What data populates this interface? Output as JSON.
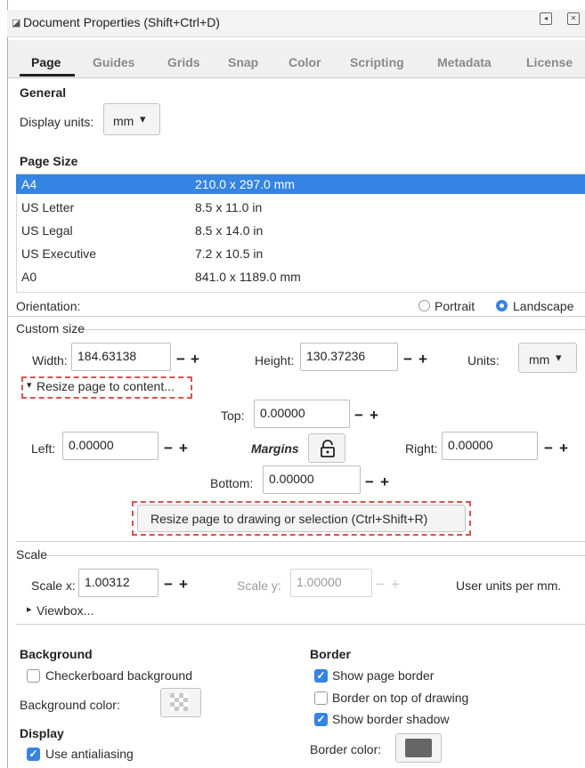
{
  "window": {
    "title": "Document Properties (Shift+Ctrl+D)",
    "restore_glyph": "◂",
    "close_glyph": "✕"
  },
  "tabs": [
    "Page",
    "Guides",
    "Grids",
    "Snap",
    "Color",
    "Scripting",
    "Metadata",
    "License"
  ],
  "general": {
    "heading": "General",
    "display_units_label": "Display units:",
    "display_units_value": "mm"
  },
  "page_size": {
    "heading": "Page Size",
    "rows": [
      {
        "name": "A4",
        "size": "210.0 x 297.0 mm",
        "selected": true
      },
      {
        "name": "US Letter",
        "size": "8.5 x 11.0 in"
      },
      {
        "name": "US Legal",
        "size": "8.5 x 14.0 in"
      },
      {
        "name": "US Executive",
        "size": "7.2 x 10.5 in"
      },
      {
        "name": "A0",
        "size": "841.0 x 1189.0 mm"
      }
    ]
  },
  "orientation": {
    "label": "Orientation:",
    "portrait": "Portrait",
    "landscape": "Landscape",
    "selected": "Landscape"
  },
  "custom_size": {
    "legend": "Custom size",
    "width_label": "Width:",
    "width_value": "184.63138",
    "height_label": "Height:",
    "height_value": "130.37236",
    "units_label": "Units:",
    "units_value": "mm",
    "resize_expander": "Resize page to content...",
    "top_label": "Top:",
    "top_value": "0.00000",
    "left_label": "Left:",
    "left_value": "0.00000",
    "margins_label": "Margins",
    "right_label": "Right:",
    "right_value": "0.00000",
    "bottom_label": "Bottom:",
    "bottom_value": "0.00000",
    "resize_button": "Resize page to drawing or selection (Ctrl+Shift+R)"
  },
  "scale": {
    "legend": "Scale",
    "scale_x_label": "Scale x:",
    "scale_x_value": "1.00312",
    "scale_y_label": "Scale y:",
    "scale_y_value": "1.00000",
    "user_units": "User units per mm.",
    "viewbox": "Viewbox..."
  },
  "background": {
    "heading": "Background",
    "checkerboard": "Checkerboard background",
    "checkerboard_checked": false,
    "color_label": "Background color:"
  },
  "border": {
    "heading": "Border",
    "show_page_border": "Show page border",
    "show_page_border_checked": true,
    "border_on_top": "Border on top of drawing",
    "border_on_top_checked": false,
    "show_shadow": "Show border shadow",
    "show_shadow_checked": true,
    "color_label": "Border color:",
    "color_value": "#666666"
  },
  "display": {
    "heading": "Display",
    "antialiasing": "Use antialiasing",
    "antialiasing_checked": true
  },
  "glyphs": {
    "minus": "−",
    "plus": "+",
    "dropdown": "▾",
    "expanded": "▾",
    "collapsed": "▸",
    "check": "✓"
  },
  "colors": {
    "accent": "#3584e4",
    "highlight_dash": "#d9534f"
  }
}
